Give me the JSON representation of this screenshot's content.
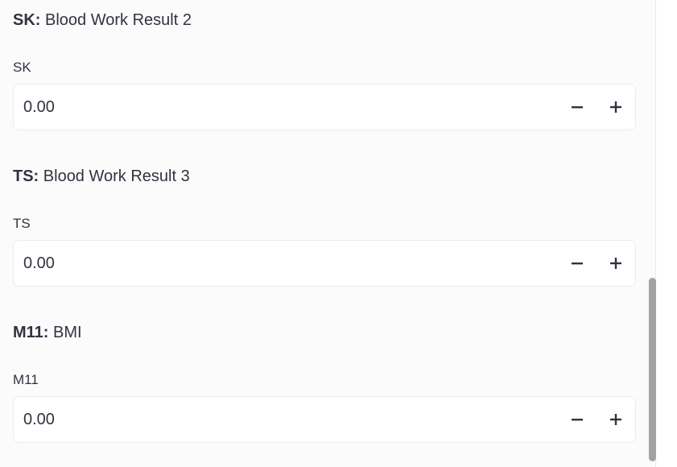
{
  "fields": [
    {
      "code": "SK:",
      "description": "Blood Work Result 2",
      "label": "SK",
      "value": "0.00"
    },
    {
      "code": "TS:",
      "description": "Blood Work Result 3",
      "label": "TS",
      "value": "0.00"
    },
    {
      "code": "M11:",
      "description": "BMI",
      "label": "M11",
      "value": "0.00"
    }
  ],
  "icons": {
    "decrement": "minus-icon",
    "increment": "plus-icon"
  },
  "colors": {
    "text": "#31333f",
    "panel_background": "#fbfbfc",
    "input_background": "#ffffff",
    "scrollbar_thumb": "#a3a3a7"
  }
}
